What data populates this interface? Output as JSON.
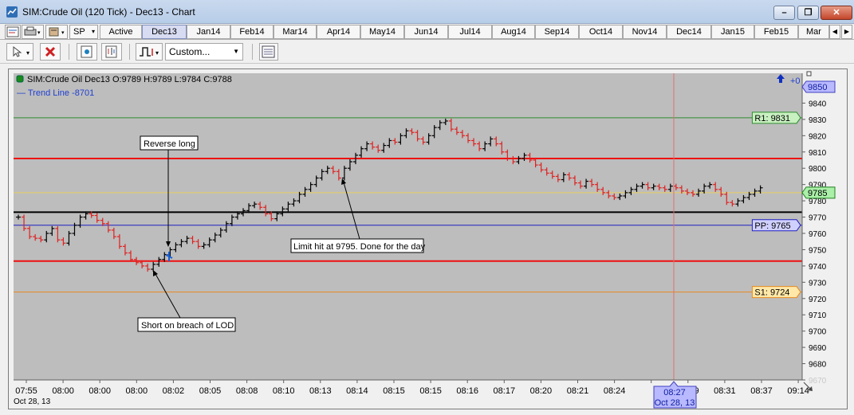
{
  "window": {
    "title": "SIM:Crude Oil (120 Tick) - Dec13 - Chart",
    "minimize_label": "–",
    "restore_label": "❐",
    "close_label": "✕"
  },
  "tabs": {
    "instrument_label": "SP",
    "items": [
      "Active",
      "Dec13",
      "Jan14",
      "Feb14",
      "Mar14",
      "Apr14",
      "May14",
      "Jun14",
      "Jul14",
      "Aug14",
      "Sep14",
      "Oct14",
      "Nov14",
      "Dec14",
      "Jan15",
      "Feb15",
      "Mar"
    ],
    "selected": "Dec13",
    "scroll_left": "◀",
    "scroll_right": "▶"
  },
  "toolbar": {
    "bar_type": "Custom..."
  },
  "chart": {
    "header": "SIM:Crude Oil Dec13 O:9789 H:9789 L:9784 C:9788",
    "trend_line_label": "— Trend Line  -8701",
    "position_indicator": "+0",
    "price_ticks": [
      "9850",
      "9840",
      "9830",
      "9820",
      "9810",
      "9800",
      "9790",
      "9780",
      "9770",
      "9760",
      "9750",
      "9740",
      "9730",
      "9720",
      "9710",
      "9700",
      "9690",
      "9680",
      "9670"
    ],
    "time_ticks": [
      "07:55",
      "08:00",
      "08:00",
      "08:00",
      "08:02",
      "08:05",
      "08:08",
      "08:10",
      "08:13",
      "08:14",
      "08:15",
      "08:15",
      "08:16",
      "08:17",
      "08:20",
      "08:21",
      "08:24",
      "08:27",
      "08:29",
      "08:31",
      "08:37",
      "09:14"
    ],
    "date_label": "Oct 28, 13",
    "crosshair_time": "08:27",
    "crosshair_date": "Oct 28, 13",
    "last_price_tag": "9785",
    "top_price_tag": "9850",
    "levels": [
      {
        "label": "R1: 9831",
        "price": 9831,
        "color": "#2e8b2e",
        "tag_bg": "#c8f0c0"
      },
      {
        "label": "PP: 9765",
        "price": 9765,
        "color": "#2020c0",
        "tag_bg": "#d0d0ff"
      },
      {
        "label": "S1: 9724",
        "price": 9724,
        "color": "#e88a20",
        "tag_bg": "#ffe8a8"
      }
    ],
    "red_lines": [
      9806,
      9743
    ],
    "black_line": 9773,
    "yellow_line": 9785,
    "annotations": {
      "reverse_long": "Reverse long",
      "limit_hit": "Limit hit at 9795. Done for the day",
      "short_breach": "Short on breach of LOD"
    },
    "colors": {
      "background": "#bdbdbd",
      "up_bar": "#000000",
      "down_bar": "#e02020",
      "crosshair": "#e07070"
    }
  },
  "chart_data": {
    "type": "line",
    "x_labels": [
      "07:55",
      "08:00",
      "08:00",
      "08:00",
      "08:02",
      "08:05",
      "08:08",
      "08:10",
      "08:13",
      "08:14",
      "08:15",
      "08:15",
      "08:16",
      "08:17",
      "08:20",
      "08:21",
      "08:24",
      "08:27",
      "08:29",
      "08:31",
      "08:37"
    ],
    "series": [
      {
        "close": [
          9770,
          9763,
          9758,
          9757,
          9756,
          9760,
          9763,
          9756,
          9754,
          9760,
          9765,
          9770,
          9772,
          9771,
          9768,
          9766,
          9762,
          9758,
          9752,
          9748,
          9744,
          9742,
          9740,
          9738,
          9741,
          9744,
          9747,
          9750,
          9753,
          9755,
          9757,
          9755,
          9752,
          9753,
          9756,
          9759,
          9762,
          9766,
          9770,
          9772,
          9774,
          9777,
          9778,
          9776,
          9772,
          9769,
          9772,
          9775,
          9778,
          9780,
          9784,
          9787,
          9790,
          9794,
          9798,
          9800,
          9798,
          9794,
          9800,
          9804,
          9808,
          9812,
          9815,
          9813,
          9811,
          9814,
          9817,
          9816,
          9820,
          9823,
          9822,
          9818,
          9816,
          9820,
          9825,
          9828,
          9829,
          9824,
          9822,
          9820,
          9817,
          9815,
          9812,
          9815,
          9818,
          9815,
          9810,
          9806,
          9804,
          9806,
          9808,
          9805,
          9802,
          9799,
          9797,
          9795,
          9793,
          9796,
          9794,
          9791,
          9789,
          9792,
          9790,
          9787,
          9785,
          9783,
          9782,
          9783,
          9785,
          9787,
          9789,
          9790,
          9788,
          9789,
          9788,
          9787,
          9789,
          9788,
          9786,
          9785,
          9784,
          9786,
          9789,
          9790,
          9787,
          9784,
          9779,
          9778,
          9780,
          9782,
          9784,
          9786,
          9788
        ]
      }
    ],
    "ylim": [
      9670,
      9855
    ],
    "ylabel": "",
    "xlabel": ""
  }
}
